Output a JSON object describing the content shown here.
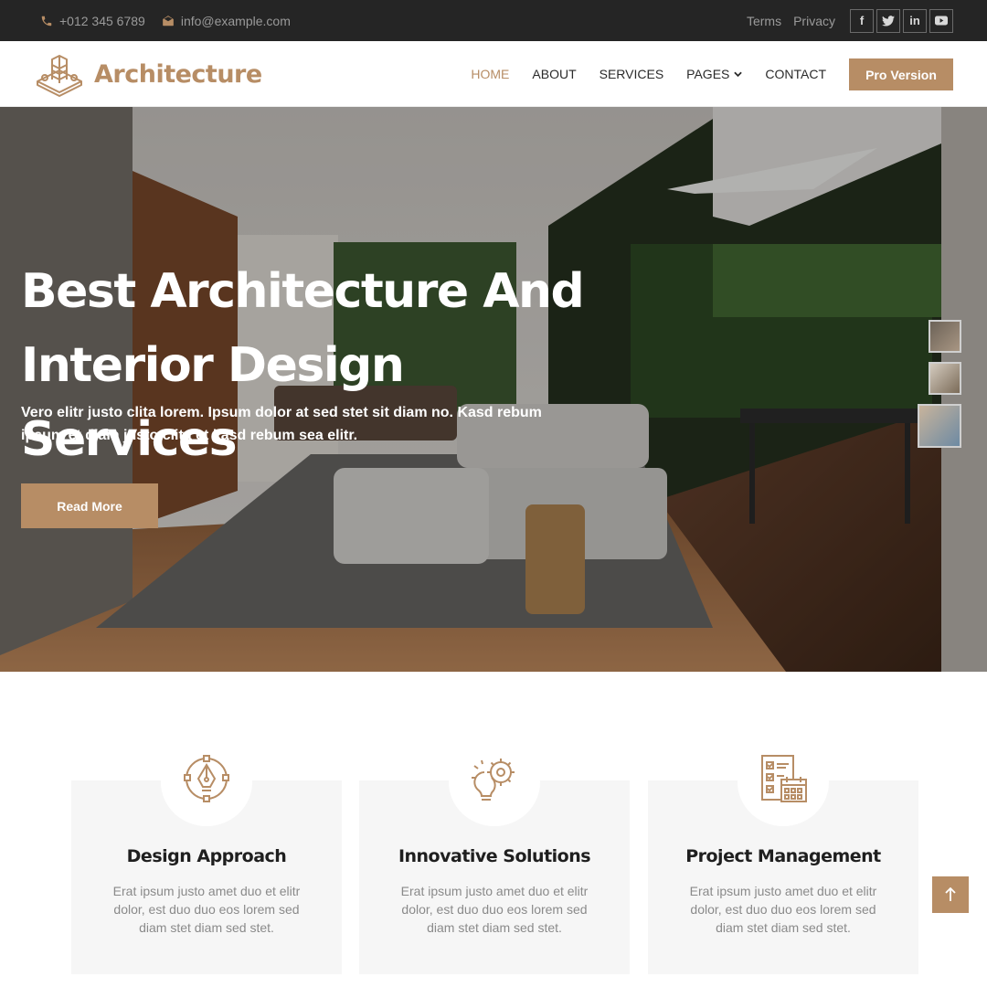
{
  "colors": {
    "accent": "#b78d65",
    "dark": "#252525"
  },
  "topbar": {
    "phone": "+012 345 6789",
    "email": "info@example.com",
    "links": [
      "Terms",
      "Privacy"
    ],
    "social_icons": [
      "facebook-icon",
      "twitter-icon",
      "linkedin-icon",
      "youtube-icon"
    ]
  },
  "brand": {
    "name": "Architecture",
    "icon": "building-logo-icon"
  },
  "nav": {
    "items": [
      "HOME",
      "ABOUT",
      "SERVICES",
      "PAGES",
      "CONTACT"
    ],
    "active": "HOME",
    "pro_button": "Pro Version"
  },
  "hero": {
    "title_line1": "Best Architecture And",
    "title_line2": "Interior Design Services",
    "text": "Vero elitr justo clita lorem. Ipsum dolor at sed stet sit diam no. Kasd rebum ipsum et diam justo clita et kasd rebum sea elitr.",
    "button": "Read More"
  },
  "services": [
    {
      "icon": "pen-tool-icon",
      "title": "Design Approach",
      "text": "Erat ipsum justo amet duo et elitr dolor, est duo duo eos lorem sed diam stet diam sed stet."
    },
    {
      "icon": "gear-bulb-icon",
      "title": "Innovative Solutions",
      "text": "Erat ipsum justo amet duo et elitr dolor, est duo duo eos lorem sed diam stet diam sed stet."
    },
    {
      "icon": "checklist-calendar-icon",
      "title": "Project Management",
      "text": "Erat ipsum justo amet duo et elitr dolor, est duo duo eos lorem sed diam stet diam sed stet."
    }
  ]
}
